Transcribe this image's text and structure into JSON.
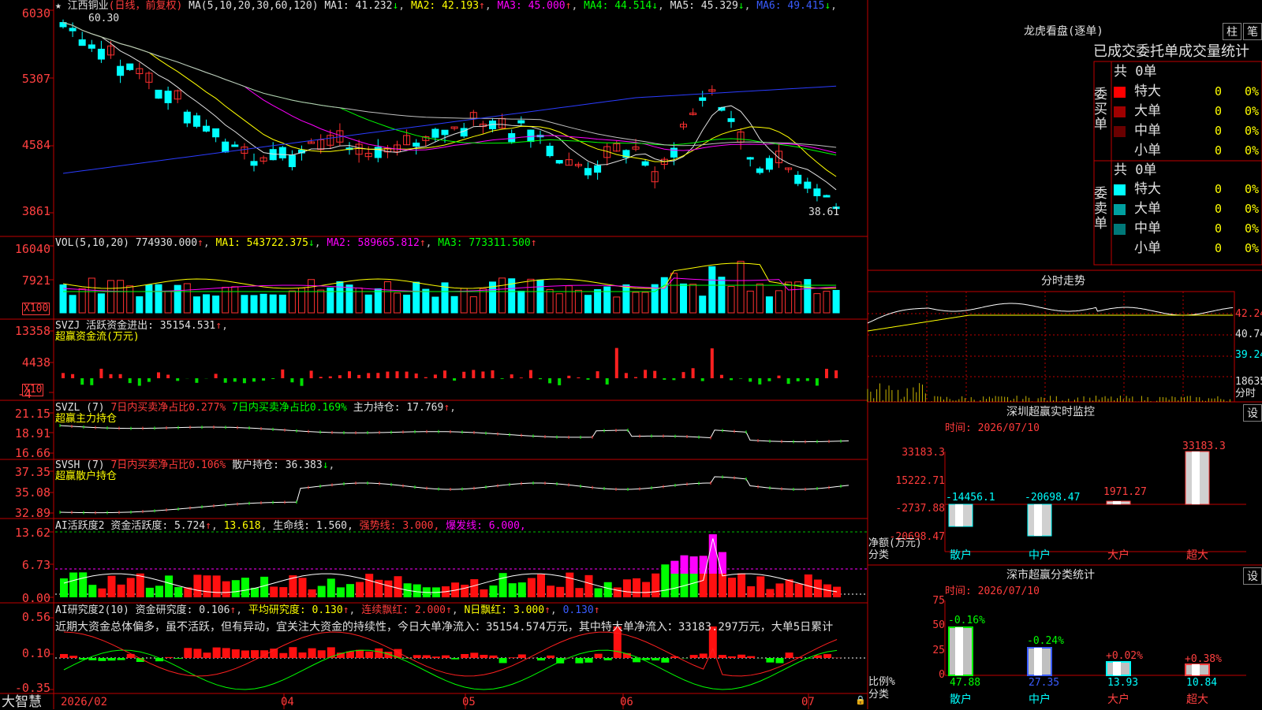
{
  "main": {
    "stock_name": "江西铜业",
    "mode": "(日线，前复权)",
    "ma_header": "MA(5,10,20,30,60,120)",
    "ma_vals": [
      {
        "label": "MA1:",
        "val": "41.232",
        "arrow": "↓",
        "color": "#e0e0e0"
      },
      {
        "label": "MA2:",
        "val": "42.193",
        "arrow": "↑",
        "color": "#ffff00"
      },
      {
        "label": "MA3:",
        "val": "45.000",
        "arrow": "↑",
        "color": "#ff00ff"
      },
      {
        "label": "MA4:",
        "val": "44.514",
        "arrow": "↓",
        "color": "#00ff00"
      },
      {
        "label": "MA5:",
        "val": "45.329",
        "arrow": "↓",
        "color": "#e0e0e0"
      },
      {
        "label": "MA6:",
        "val": "49.415",
        "arrow": "↓",
        "color": "#3a5cff"
      }
    ],
    "yticks": [
      "6030",
      "5307",
      "4584",
      "3861"
    ],
    "high_label": "60.30",
    "low_label": "38.61"
  },
  "vol": {
    "header": "VOL(5,10,20)",
    "val": "774930.000",
    "ma1": "MA1: 543722.375",
    "ma2": "MA2: 589665.812",
    "ma3": "MA3: 773311.500",
    "yticks": [
      "16040",
      "7921"
    ],
    "unit": "X100"
  },
  "svzj": {
    "header": "SVZJ  活跃资金进出:",
    "val": "35154.531",
    "sub": "超赢资金流(万元)",
    "yticks": [
      "13358",
      "4438",
      "-4"
    ],
    "unit": "X10"
  },
  "svzl": {
    "header": "SVZL (7)",
    "a": "7日内买卖净占比0.277%",
    "b": "7日内买卖净占比0.169%",
    "c": "主力持仓: 17.769",
    "sub": "超赢主力持仓",
    "yticks": [
      "21.15",
      "18.91",
      "16.66"
    ]
  },
  "svsh": {
    "header": "SVSH (7)",
    "a": "7日内买卖净占比0.106%",
    "c": "散户持仓: 36.383",
    "sub": "超赢散户持仓",
    "yticks": [
      "37.35",
      "35.08",
      "32.89"
    ]
  },
  "ai1": {
    "header": "AI活跃度2",
    "a": "资金活跃度: 5.724",
    "b": "13.618",
    "c": "生命线: 1.560,",
    "d": "强势线: 3.000,",
    "e": "爆发线: 6.000,",
    "yticks": [
      "13.62",
      "6.73",
      "0.00"
    ]
  },
  "ai2": {
    "header": "AI研究度2(10)",
    "a": "资金研究度: 0.106",
    "b": "平均研究度: 0.130",
    "c": "连续飘红: 2.000",
    "d": "N日飘红: 3.000",
    "e": "0.130",
    "text": "近期大资金总体偏多，虽不活跃，但有异动，宜关注大资金的持续性，今日大单净流入：35154.574万元，其中特大单净流入：33183.297万元，大单5日累计",
    "yticks": [
      "0.56",
      "0.10",
      "-0.35"
    ]
  },
  "xaxis": {
    "brand": "大智慧",
    "labels": [
      "2026/02",
      "04",
      "05",
      "06",
      "07"
    ]
  },
  "right": {
    "lhkp": "龙虎看盘(逐单)",
    "btn1": "柱",
    "btn2": "笔",
    "stats_title": "已成交委托单成交量统计",
    "buy_title": "委买单",
    "sell_title": "委卖单",
    "buy_total": "共 0单",
    "sell_total": "共 0单",
    "buy_rows": [
      {
        "name": "特大",
        "n": "0",
        "p": "0%",
        "color": "#ff0000"
      },
      {
        "name": "大单",
        "n": "0",
        "p": "0%",
        "color": "#a00000"
      },
      {
        "name": "中单",
        "n": "0",
        "p": "0%",
        "color": "#6a0000"
      },
      {
        "name": "小单",
        "n": "0",
        "p": "0%",
        "color": ""
      }
    ],
    "sell_rows": [
      {
        "name": "特大",
        "n": "0",
        "p": "0%",
        "color": "#00ffff"
      },
      {
        "name": "大单",
        "n": "0",
        "p": "0%",
        "color": "#00a0a0"
      },
      {
        "name": "中单",
        "n": "0",
        "p": "0%",
        "color": "#007878"
      },
      {
        "name": "小单",
        "n": "0",
        "p": "0%",
        "color": ""
      }
    ],
    "fs_title": "分时走势",
    "fs_ticks": [
      "42.24",
      "40.74",
      "39.24",
      "18635"
    ],
    "fs_unit": "分时",
    "mon_title": "深圳超赢实时监控",
    "mon_set": "设",
    "mon_time": "时间: 2026/07/10",
    "mon_ticks": [
      "33183.3",
      "15222.71",
      "-2737.88",
      "-20698.47"
    ],
    "mon_bars": [
      {
        "cat": "散户",
        "val": "-14456.1"
      },
      {
        "cat": "中户",
        "val": "-20698.47"
      },
      {
        "cat": "大户",
        "val": "1971.27"
      },
      {
        "cat": "超大",
        "val": "33183.3"
      }
    ],
    "mon_ylabel": "净额(万元)",
    "mon_xlabel": "分类",
    "cls_title": "深市超赢分类统计",
    "cls_set": "设",
    "cls_time": "时间: 2026/07/10",
    "cls_ticks": [
      "75",
      "50",
      "25",
      "0"
    ],
    "cls_bars": [
      {
        "cat": "散户",
        "top": "-0.16%",
        "bottom": "47.88"
      },
      {
        "cat": "中户",
        "top": "-0.24%",
        "bottom": "27.35"
      },
      {
        "cat": "大户",
        "top": "+0.02%",
        "bottom": "13.93"
      },
      {
        "cat": "超大",
        "top": "+0.38%",
        "bottom": "10.84"
      }
    ],
    "cls_ylabel": "比例%",
    "cls_xlabel": "分类"
  }
}
